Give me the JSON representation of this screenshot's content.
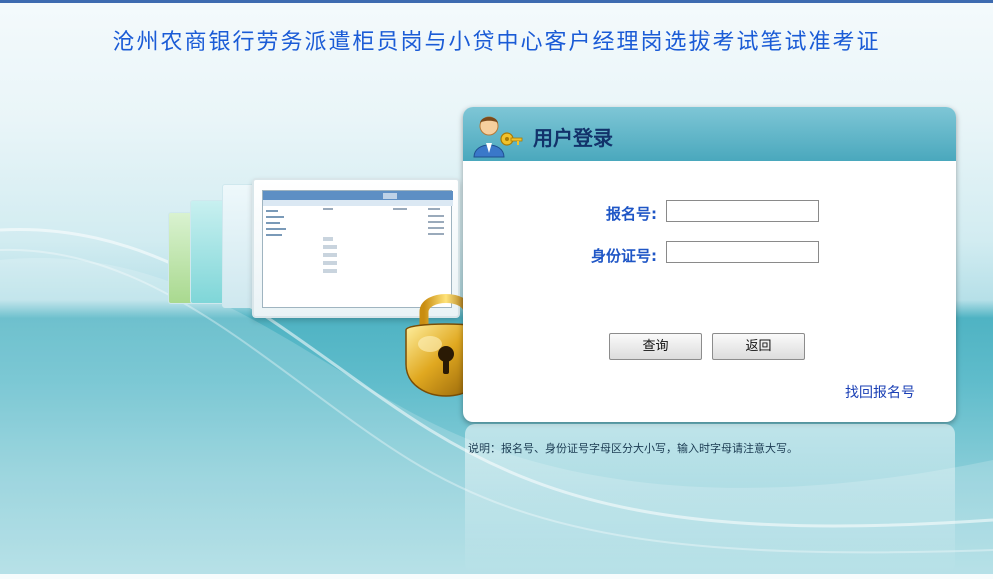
{
  "page": {
    "title": "沧州农商银行劳务派遣柜员岗与小贷中心客户经理岗选拔考试笔试准考证"
  },
  "login": {
    "title": "用户登录",
    "reg_no_label": "报名号:",
    "reg_no_value": "",
    "id_no_label": "身份证号:",
    "id_no_value": "",
    "query_button": "查询",
    "back_button": "返回",
    "recover_link": "找回报名号"
  },
  "note": "说明：报名号、身份证号字母区分大小写，输入时字母请注意大写。",
  "icons": {
    "user": "user-key-icon",
    "padlock": "padlock-icon",
    "illustration": "monitor-illustration"
  },
  "colors": {
    "title": "#1a5bd6",
    "header_band": "#4aa8bd",
    "label": "#1f56c6",
    "link": "#1a3fb5"
  }
}
